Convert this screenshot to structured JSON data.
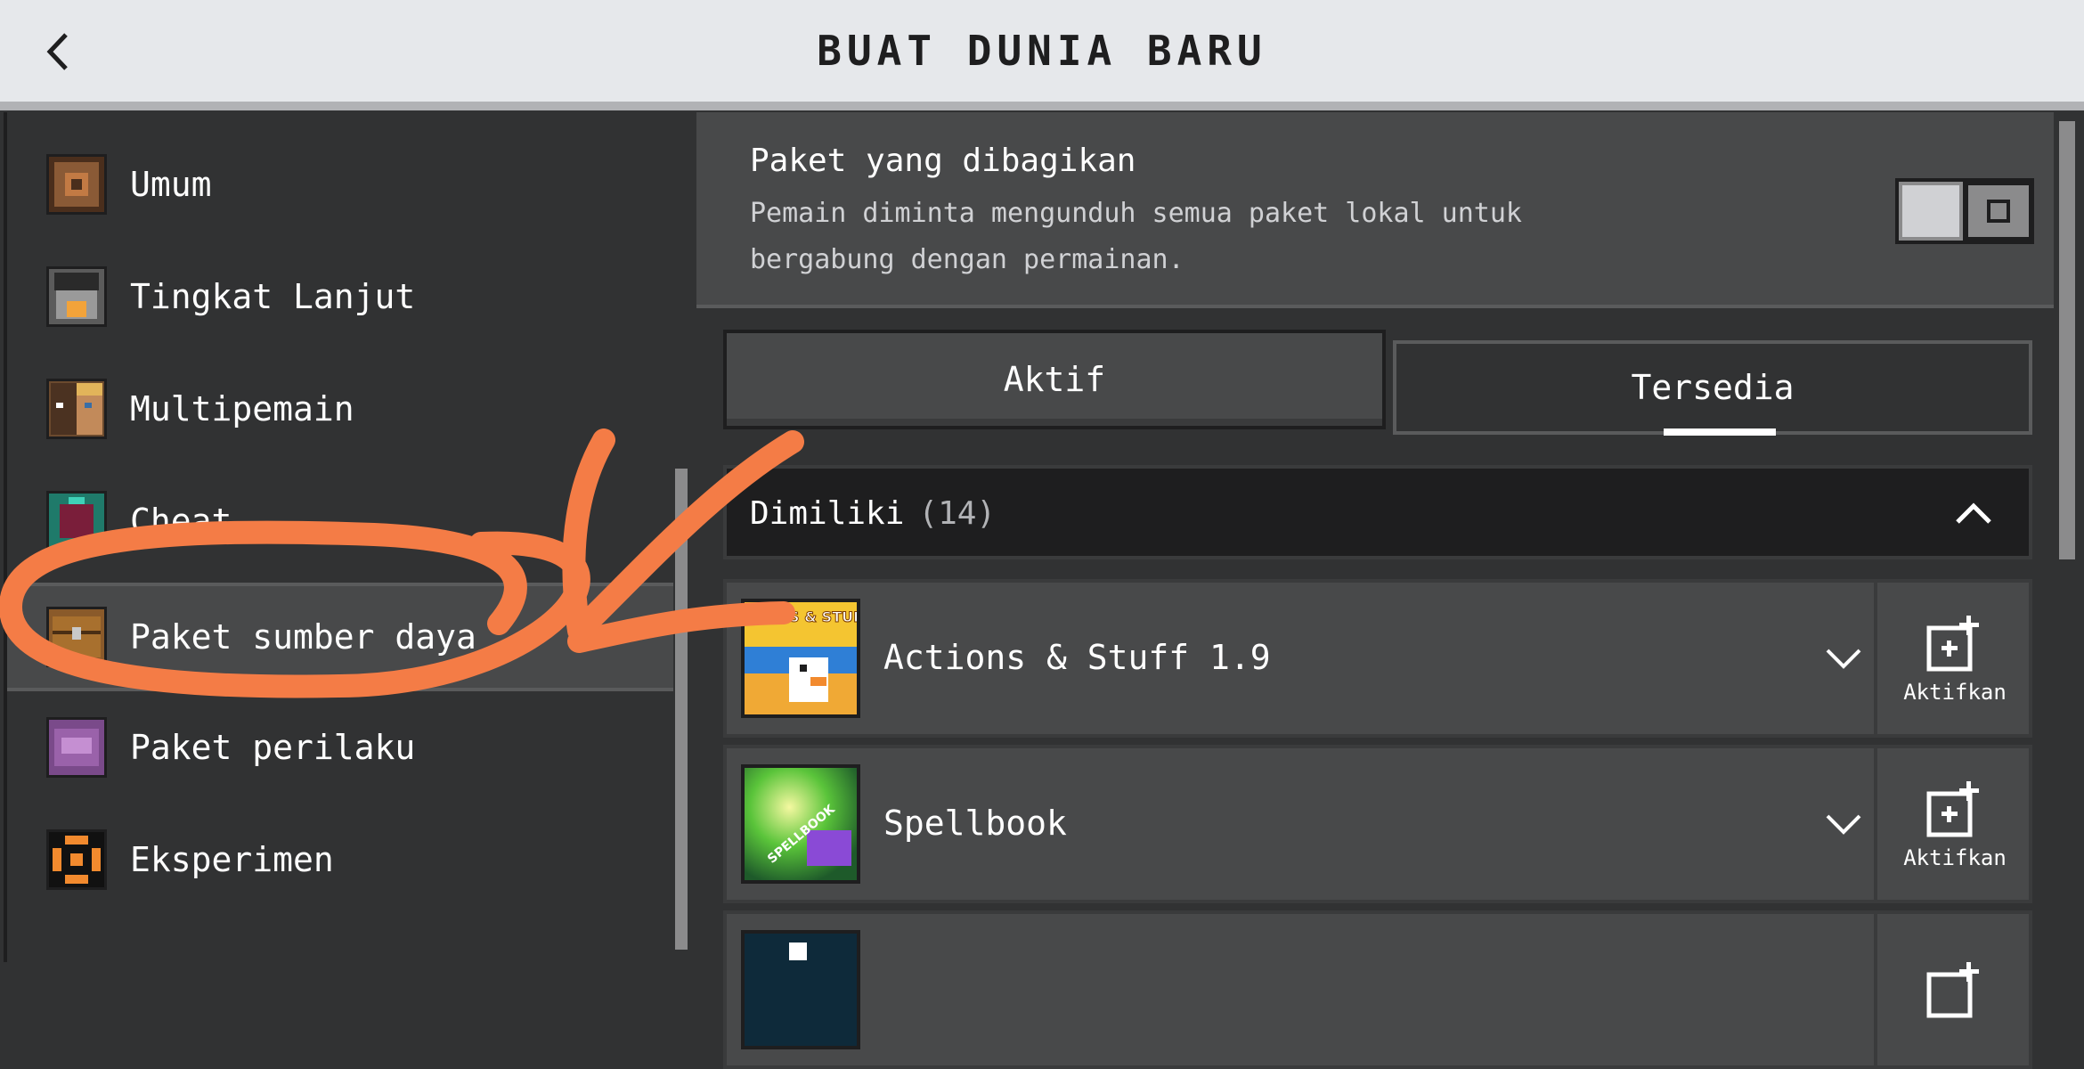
{
  "header": {
    "title": "BUAT DUNIA BARU"
  },
  "sidebar": {
    "items": [
      {
        "label": "Umum",
        "icon": "gear-icon"
      },
      {
        "label": "Tingkat Lanjut",
        "icon": "furnace-icon"
      },
      {
        "label": "Multipemain",
        "icon": "players-icon"
      },
      {
        "label": "Cheat",
        "icon": "cheat-icon"
      },
      {
        "label": "Paket sumber daya",
        "icon": "chest-icon",
        "selected": true
      },
      {
        "label": "Paket perilaku",
        "icon": "behavior-icon"
      },
      {
        "label": "Eksperimen",
        "icon": "experiment-icon"
      }
    ]
  },
  "shared_packs": {
    "title": "Paket yang dibagikan",
    "description": "Pemain diminta mengunduh semua paket lokal untuk bergabung dengan permainan.",
    "toggle_on": false
  },
  "tabs": {
    "active": "Aktif",
    "available": "Tersedia",
    "selected": "Tersedia"
  },
  "owned": {
    "label": "Dimiliki",
    "count": "(14)",
    "expanded": true
  },
  "packs": [
    {
      "name": "Actions & Stuff 1.9",
      "activate_label": "Aktifkan",
      "thumb_text": "ACTIONS & STUFF"
    },
    {
      "name": "Spellbook",
      "activate_label": "Aktifkan",
      "thumb_text": "SPELLBOOK"
    },
    {
      "name": "",
      "activate_label": ""
    }
  ],
  "colors": {
    "header_bg": "#e6e8eb",
    "panel_bg": "#313233",
    "row_bg": "#48494a",
    "annotation": "#f47c46"
  }
}
